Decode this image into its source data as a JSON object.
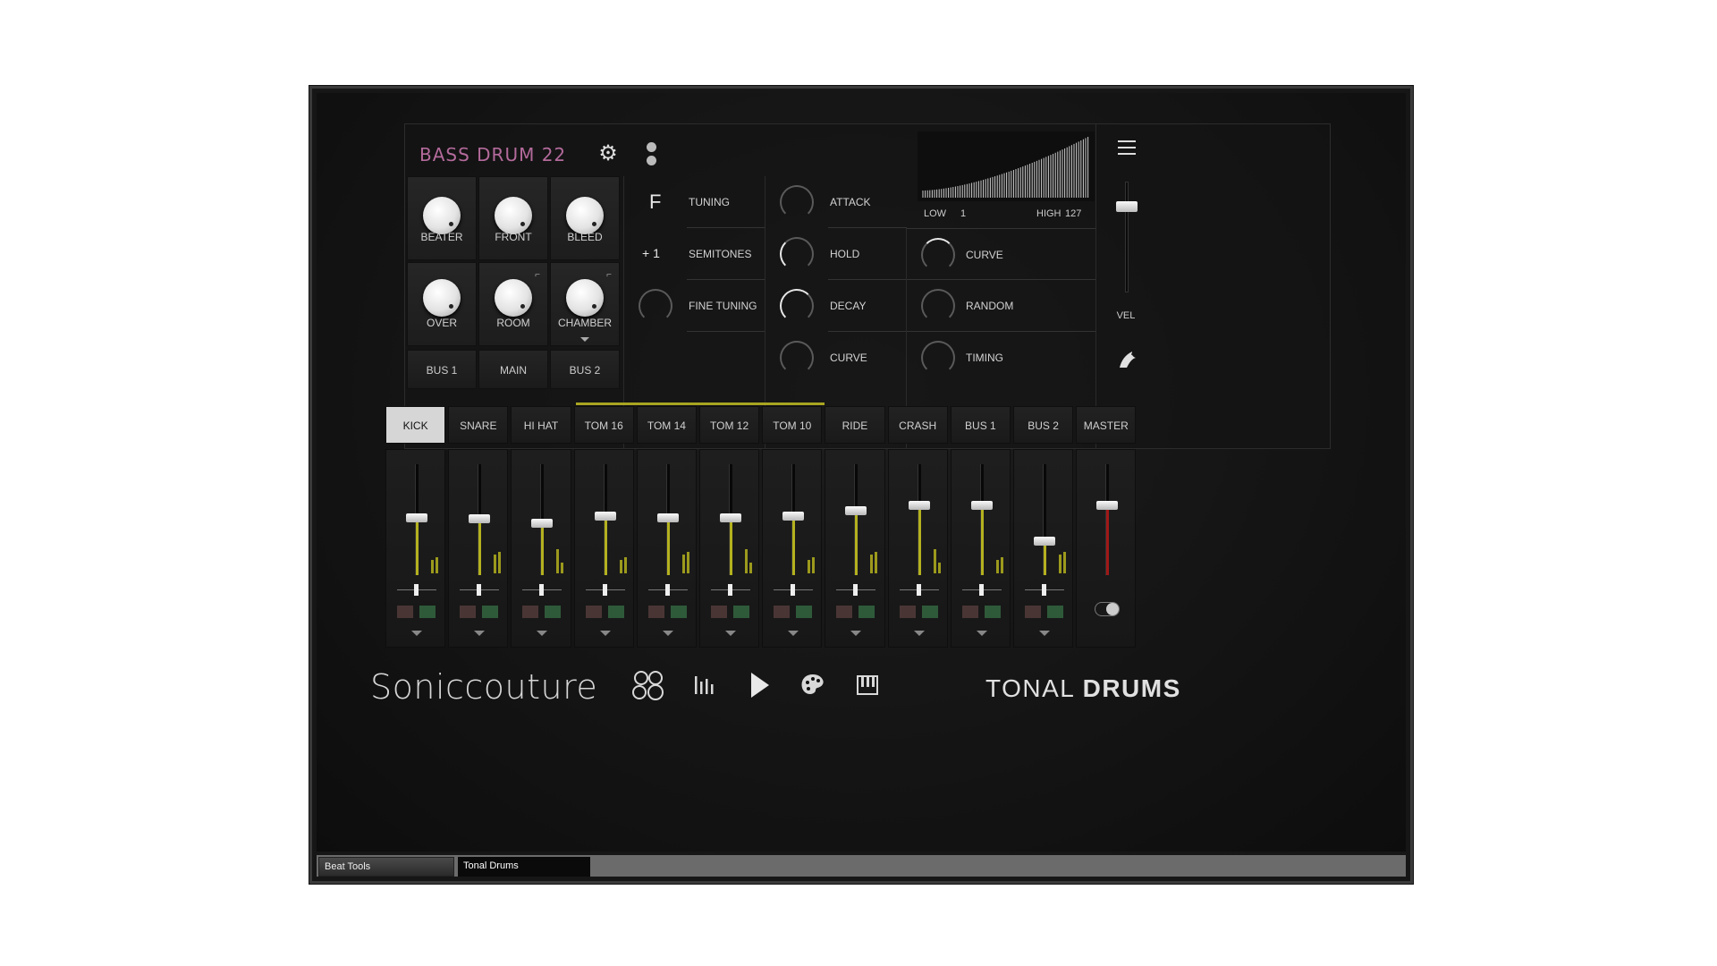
{
  "instrument": {
    "preset_name": "BASS DRUM 22",
    "icons": {
      "settings": "gear-icon",
      "link": "link-icon",
      "menu": "hamburger-menu-icon",
      "bird": "bird-icon"
    }
  },
  "mic_knobs": [
    {
      "label": "BEATER"
    },
    {
      "label": "FRONT"
    },
    {
      "label": "BLEED"
    },
    {
      "label": "OVER"
    },
    {
      "label": "ROOM",
      "corner": "⌐"
    },
    {
      "label": "CHAMBER",
      "corner": "⌐"
    }
  ],
  "bus_buttons": [
    "BUS 1",
    "MAIN",
    "BUS 2"
  ],
  "tuning": {
    "tuning_label": "TUNING",
    "tuning_value": "F",
    "semitones_label": "SEMITONES",
    "semitones_value": "+ 1",
    "fine_label": "FINE TUNING"
  },
  "envelope": {
    "attack": "ATTACK",
    "hold": "HOLD",
    "decay": "DECAY",
    "curve": "CURVE"
  },
  "velocity": {
    "low_label": "LOW",
    "low_value": "1",
    "high_label": "HIGH",
    "high_value": "127",
    "curve": "CURVE",
    "random": "RANDOM",
    "timing": "TIMING",
    "vel_label": "VEL"
  },
  "mixer": {
    "channels": [
      "KICK",
      "SNARE",
      "HI HAT",
      "TOM 16",
      "TOM 14",
      "TOM 12",
      "TOM 10",
      "RIDE",
      "CRASH",
      "BUS 1",
      "BUS 2",
      "MASTER"
    ],
    "active_channel": "KICK",
    "fader_levels": [
      0.52,
      0.51,
      0.47,
      0.53,
      0.52,
      0.52,
      0.53,
      0.58,
      0.63,
      0.63,
      0.31,
      0.63
    ],
    "colors": {
      "fader_fill": "#b4b11f",
      "master_fill": "#a01818",
      "tom_group": "#a9a521"
    }
  },
  "footer": {
    "brand": "Soniccouture",
    "product_light": "TONAL",
    "product_bold": "DRUMS",
    "nav_icons": [
      "kit-icon",
      "mixer-icon",
      "play-icon",
      "palette-icon",
      "keyboard-icon"
    ]
  },
  "host": {
    "tabs": [
      "Beat Tools",
      "Tonal Drums"
    ]
  }
}
